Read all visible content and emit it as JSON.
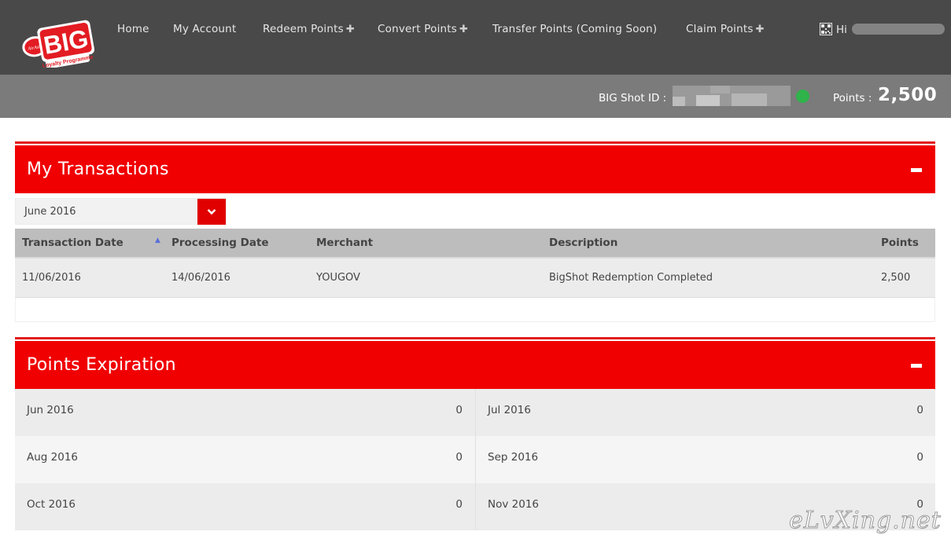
{
  "brand": {
    "logo_text": "BIG",
    "logo_small": "AirAsia",
    "logo_tagline": "Loyalty Programme",
    "brand_red": "#f00000"
  },
  "nav": {
    "items": [
      {
        "label": "Home",
        "has_plus": false
      },
      {
        "label": "My Account",
        "has_plus": false
      },
      {
        "label": "Redeem Points",
        "has_plus": true
      },
      {
        "label": "Convert Points",
        "has_plus": true
      },
      {
        "label": "Transfer Points (Coming Soon)",
        "has_plus": false
      },
      {
        "label": "Claim Points",
        "has_plus": true
      }
    ],
    "plus_glyph": "✚",
    "greeting": "Hi"
  },
  "account_bar": {
    "bigshot_label": "BIG Shot ID :",
    "points_label": "Points :",
    "points_value": "2,500",
    "status_color": "#2fb34a"
  },
  "transactions": {
    "title": "My Transactions",
    "collapse_glyph": "−",
    "month_select": {
      "value": "June 2016"
    },
    "columns": [
      "Transaction Date",
      "Processing Date",
      "Merchant",
      "Description",
      "Points"
    ],
    "rows": [
      {
        "transaction_date": "11/06/2016",
        "processing_date": "14/06/2016",
        "merchant": "YOUGOV",
        "description": "BigShot Redemption Completed",
        "points": "2,500"
      }
    ]
  },
  "expiration": {
    "title": "Points Expiration",
    "rows": [
      [
        {
          "month": "Jun 2016",
          "value": "0"
        },
        {
          "month": "Jul 2016",
          "value": "0"
        }
      ],
      [
        {
          "month": "Aug 2016",
          "value": "0"
        },
        {
          "month": "Sep 2016",
          "value": "0"
        }
      ],
      [
        {
          "month": "Oct 2016",
          "value": "0"
        },
        {
          "month": "Nov 2016",
          "value": "0"
        }
      ]
    ]
  },
  "watermark": "eLvXing.net"
}
